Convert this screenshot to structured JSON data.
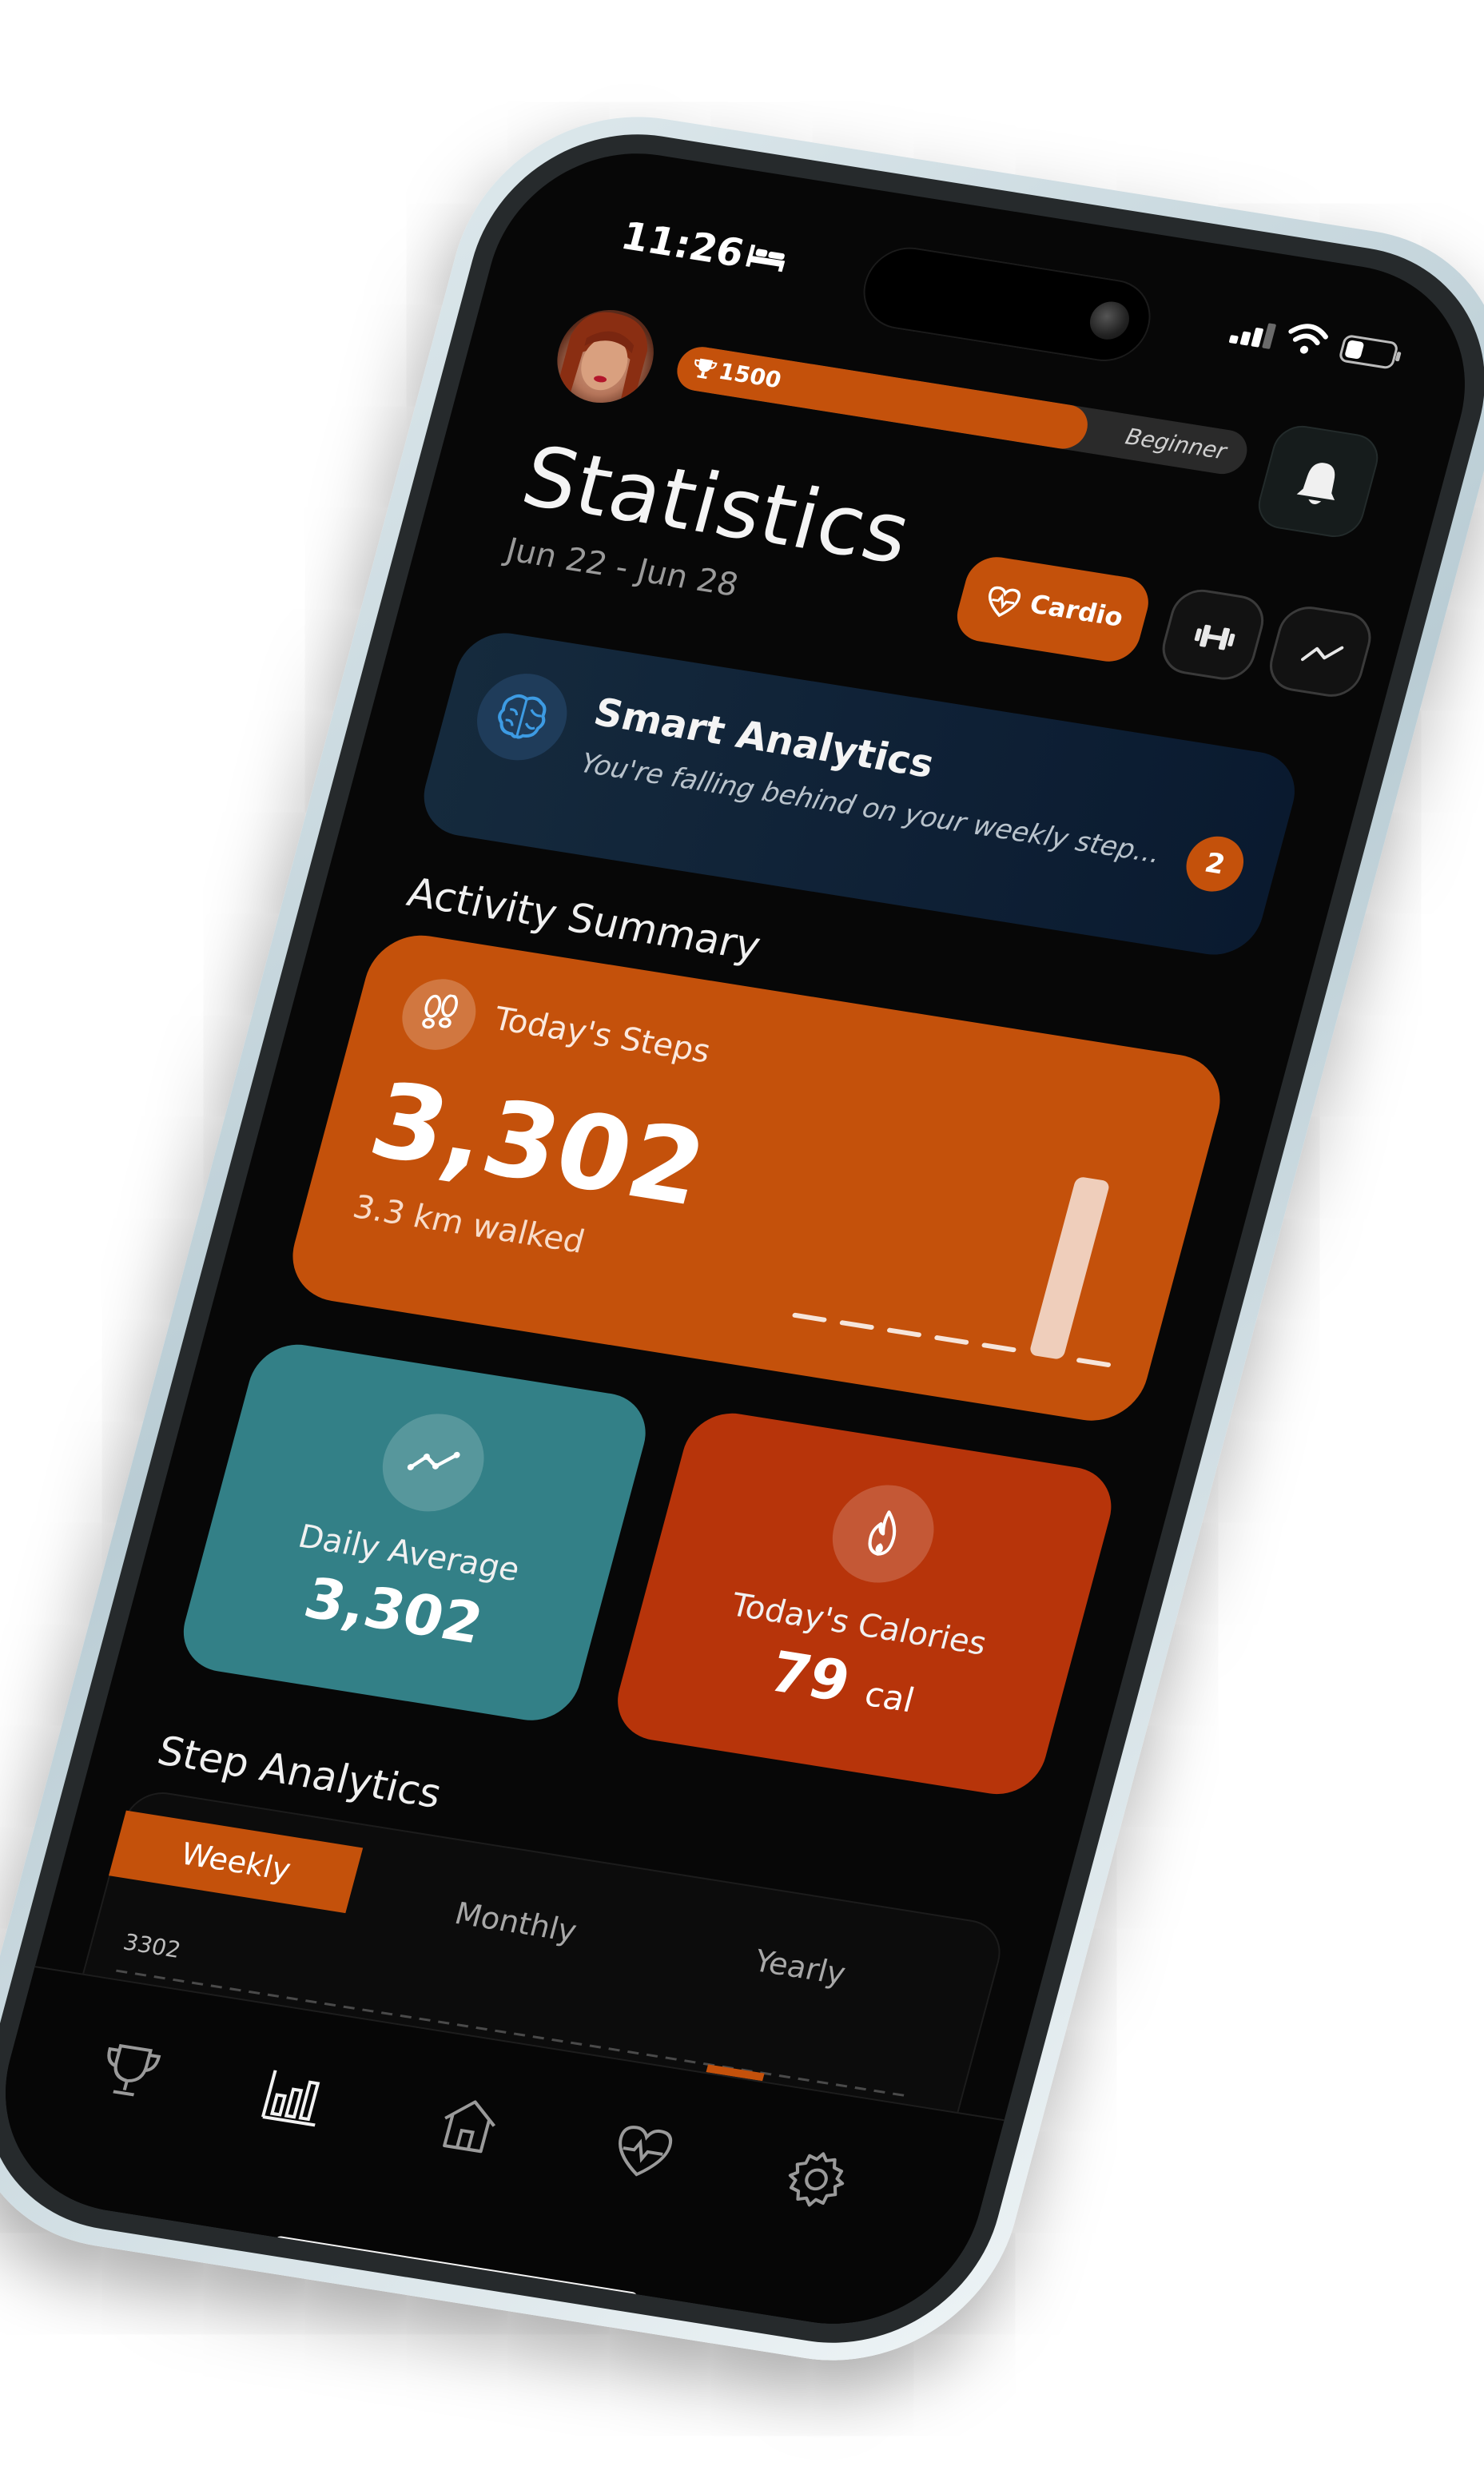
{
  "status_bar": {
    "time": "11:26",
    "focus_mode_icon": "bed-icon",
    "signal_icon": "signal-icon",
    "wifi_icon": "wifi-icon",
    "battery_icon": "battery-icon"
  },
  "header": {
    "xp_points": "1500",
    "xp_progress": 0.72,
    "level": "Beginner",
    "notification_icon": "bell-icon"
  },
  "page": {
    "title": "Statistics",
    "date_range": "Jun 22 - Jun 28"
  },
  "filters": {
    "cardio_label": "Cardio",
    "cardio_icon": "heart-pulse-icon",
    "strength_icon": "dumbbell-icon",
    "trends_icon": "trend-line-icon"
  },
  "smart_analytics": {
    "title": "Smart Analytics",
    "message": "You're falling behind on your weekly step...",
    "badge_count": "2",
    "icon": "brain-icon"
  },
  "activity_summary": {
    "section_title": "Activity Summary",
    "steps": {
      "label": "Today's Steps",
      "value": "3,302",
      "distance": "3.3 km walked",
      "icon": "footprints-icon",
      "daily_values": [
        0,
        0,
        0,
        0,
        0,
        3302,
        0
      ]
    },
    "daily_average": {
      "label": "Daily Average",
      "value": "3,302",
      "icon": "trend-line-icon"
    },
    "calories": {
      "label": "Today's Calories",
      "value": "79",
      "unit": "cal",
      "icon": "flame-icon"
    }
  },
  "step_analytics": {
    "section_title": "Step Analytics",
    "periods": [
      "Weekly",
      "Monthly",
      "Yearly"
    ],
    "selected_period": "Weekly",
    "max_value_label": "3302",
    "daily_values": [
      0,
      0,
      0,
      0,
      0,
      3302,
      0
    ]
  },
  "tab_bar": {
    "tabs": [
      "trophy-icon",
      "bar-chart-icon",
      "home-icon",
      "heart-pulse-icon",
      "gear-icon"
    ],
    "active": "bar-chart-icon"
  },
  "colors": {
    "accent": "#c4510b",
    "average_card": "#338087",
    "calories_card": "#b7340a",
    "banner": "#0f2136",
    "background": "#070707"
  }
}
